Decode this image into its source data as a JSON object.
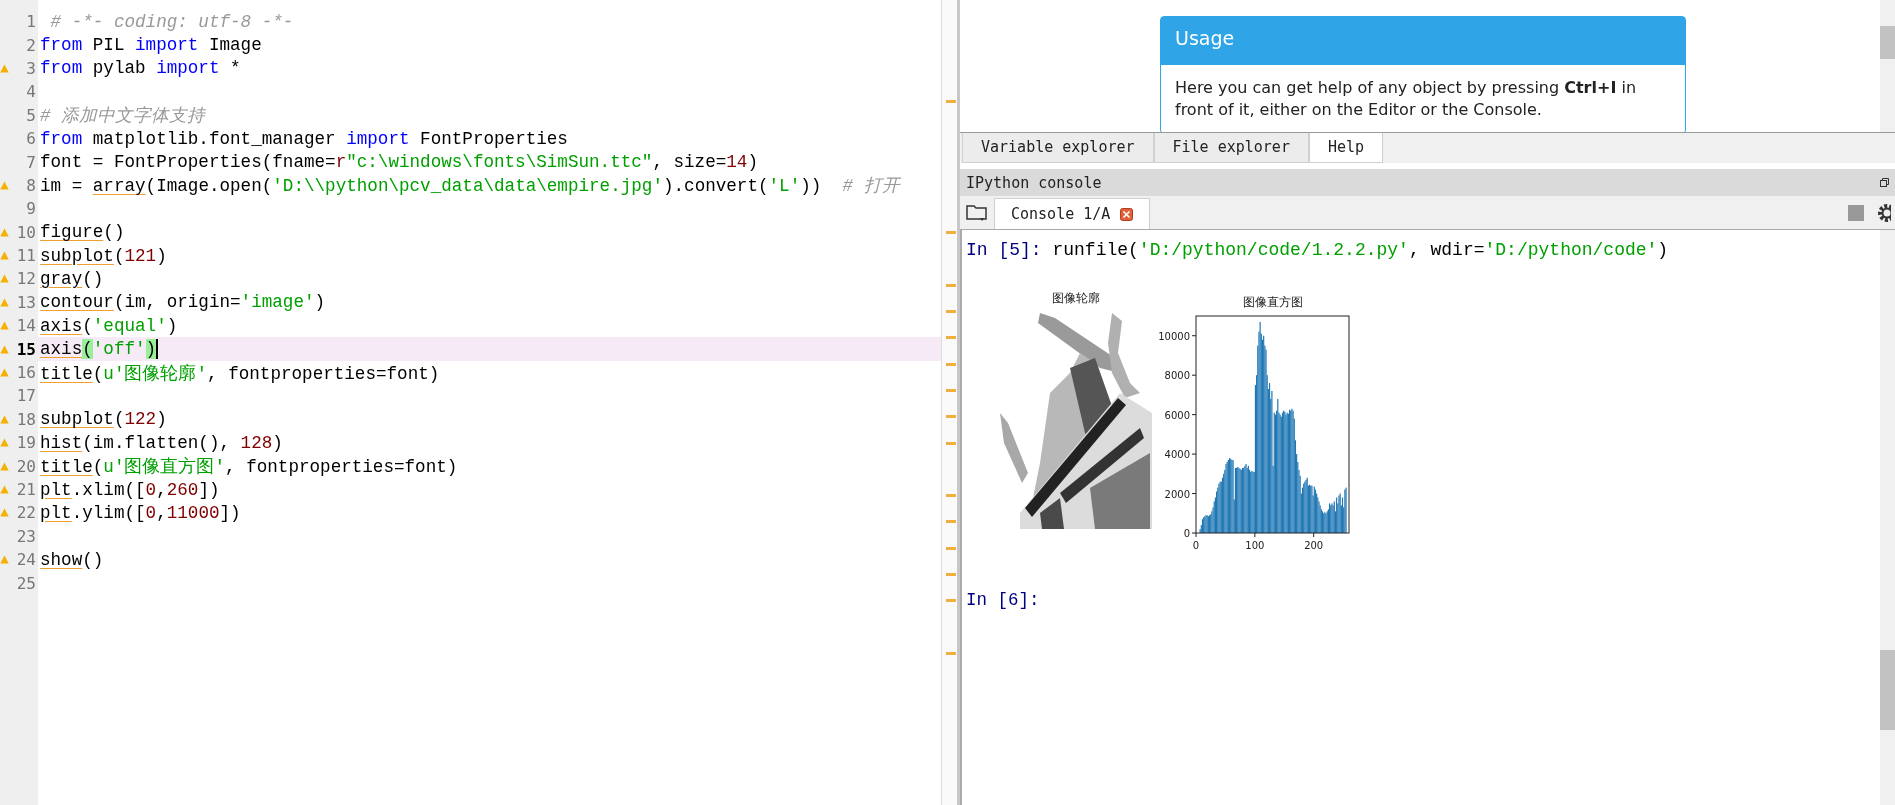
{
  "editor": {
    "lines": [
      {
        "number": "1",
        "warning": false,
        "current": false,
        "tokens": [
          {
            "text": " # -*- coding: utf-8 -*-",
            "kind": "comment"
          }
        ]
      },
      {
        "number": "2",
        "warning": false,
        "current": false,
        "tokens": [
          {
            "text": "from",
            "kind": "keyword"
          },
          {
            "text": " PIL ",
            "kind": "plain"
          },
          {
            "text": "import",
            "kind": "keyword"
          },
          {
            "text": " Image",
            "kind": "plain"
          }
        ]
      },
      {
        "number": "3",
        "warning": true,
        "current": false,
        "tokens": [
          {
            "text": "from",
            "kind": "keyword"
          },
          {
            "text": " pylab ",
            "kind": "plain"
          },
          {
            "text": "import",
            "kind": "keyword"
          },
          {
            "text": " *",
            "kind": "plain"
          }
        ]
      },
      {
        "number": "4",
        "warning": false,
        "current": false
      },
      {
        "number": "5",
        "warning": false,
        "current": false,
        "tokens": [
          {
            "text": "# 添加中文字体支持",
            "kind": "comment"
          }
        ]
      },
      {
        "number": "6",
        "warning": false,
        "current": false,
        "tokens": [
          {
            "text": "from",
            "kind": "keyword"
          },
          {
            "text": " matplotlib.font_manager ",
            "kind": "plain"
          },
          {
            "text": "import",
            "kind": "keyword"
          },
          {
            "text": " FontProperties",
            "kind": "plain"
          }
        ]
      },
      {
        "number": "7",
        "warning": false,
        "current": false,
        "tokens": [
          {
            "text": "font = FontProperties(fname=",
            "kind": "plain"
          },
          {
            "text": "r",
            "kind": "number"
          },
          {
            "text": "\"c:\\windows\\fonts\\SimSun.ttc\"",
            "kind": "string"
          },
          {
            "text": ", size=",
            "kind": "plain"
          },
          {
            "text": "14",
            "kind": "number"
          },
          {
            "text": ")",
            "kind": "plain"
          }
        ]
      },
      {
        "number": "8",
        "warning": true,
        "current": false,
        "tokens": [
          {
            "text": "im = ",
            "kind": "plain"
          },
          {
            "text": "array",
            "kind": "flagged"
          },
          {
            "text": "(Image.open(",
            "kind": "plain"
          },
          {
            "text": "'D:\\\\python\\pcv_data\\data\\empire.jpg'",
            "kind": "string"
          },
          {
            "text": ").convert(",
            "kind": "plain"
          },
          {
            "text": "'L'",
            "kind": "string"
          },
          {
            "text": "))  ",
            "kind": "plain"
          },
          {
            "text": "# 打开",
            "kind": "comment"
          }
        ]
      },
      {
        "number": "9",
        "warning": false,
        "current": false
      },
      {
        "number": "10",
        "warning": true,
        "current": false,
        "tokens": [
          {
            "text": "figure",
            "kind": "flagged"
          },
          {
            "text": "()",
            "kind": "plain"
          }
        ]
      },
      {
        "number": "11",
        "warning": true,
        "current": false,
        "tokens": [
          {
            "text": "subplot",
            "kind": "flagged"
          },
          {
            "text": "(",
            "kind": "plain"
          },
          {
            "text": "121",
            "kind": "number"
          },
          {
            "text": ")",
            "kind": "plain"
          }
        ]
      },
      {
        "number": "12",
        "warning": true,
        "current": false,
        "tokens": [
          {
            "text": "gray",
            "kind": "flagged"
          },
          {
            "text": "()",
            "kind": "plain"
          }
        ]
      },
      {
        "number": "13",
        "warning": true,
        "current": false,
        "tokens": [
          {
            "text": "contour",
            "kind": "flagged"
          },
          {
            "text": "(im, origin=",
            "kind": "plain"
          },
          {
            "text": "'image'",
            "kind": "string"
          },
          {
            "text": ")",
            "kind": "plain"
          }
        ]
      },
      {
        "number": "14",
        "warning": true,
        "current": false,
        "tokens": [
          {
            "text": "axis",
            "kind": "flagged"
          },
          {
            "text": "(",
            "kind": "plain"
          },
          {
            "text": "'equal'",
            "kind": "string"
          },
          {
            "text": ")",
            "kind": "plain"
          }
        ]
      },
      {
        "number": "15",
        "warning": true,
        "current": true,
        "tokens": [
          {
            "text": "axis",
            "kind": "flagged"
          },
          {
            "text": "(",
            "kind": "match"
          },
          {
            "text": "'off'",
            "kind": "string"
          },
          {
            "text": ")",
            "kind": "match"
          }
        ]
      },
      {
        "number": "16",
        "warning": true,
        "current": false,
        "tokens": [
          {
            "text": "title",
            "kind": "flagged"
          },
          {
            "text": "(",
            "kind": "plain"
          },
          {
            "text": "u'图像轮廓'",
            "kind": "string"
          },
          {
            "text": ", fontproperties=font)",
            "kind": "plain"
          }
        ]
      },
      {
        "number": "17",
        "warning": false,
        "current": false
      },
      {
        "number": "18",
        "warning": true,
        "current": false,
        "tokens": [
          {
            "text": "subplot",
            "kind": "flagged"
          },
          {
            "text": "(",
            "kind": "plain"
          },
          {
            "text": "122",
            "kind": "number"
          },
          {
            "text": ")",
            "kind": "plain"
          }
        ]
      },
      {
        "number": "19",
        "warning": true,
        "current": false,
        "tokens": [
          {
            "text": "hist",
            "kind": "flagged"
          },
          {
            "text": "(im.flatten(), ",
            "kind": "plain"
          },
          {
            "text": "128",
            "kind": "number"
          },
          {
            "text": ")",
            "kind": "plain"
          }
        ]
      },
      {
        "number": "20",
        "warning": true,
        "current": false,
        "tokens": [
          {
            "text": "title",
            "kind": "flagged"
          },
          {
            "text": "(",
            "kind": "plain"
          },
          {
            "text": "u'图像直方图'",
            "kind": "string"
          },
          {
            "text": ", fontproperties=font)",
            "kind": "plain"
          }
        ]
      },
      {
        "number": "21",
        "warning": true,
        "current": false,
        "tokens": [
          {
            "text": "plt",
            "kind": "flagged"
          },
          {
            "text": ".xlim([",
            "kind": "plain"
          },
          {
            "text": "0",
            "kind": "number"
          },
          {
            "text": ",",
            "kind": "plain"
          },
          {
            "text": "260",
            "kind": "number"
          },
          {
            "text": "])",
            "kind": "plain"
          }
        ]
      },
      {
        "number": "22",
        "warning": true,
        "current": false,
        "tokens": [
          {
            "text": "plt",
            "kind": "flagged"
          },
          {
            "text": ".ylim([",
            "kind": "plain"
          },
          {
            "text": "0",
            "kind": "number"
          },
          {
            "text": ",",
            "kind": "plain"
          },
          {
            "text": "11000",
            "kind": "number"
          },
          {
            "text": "])",
            "kind": "plain"
          }
        ]
      },
      {
        "number": "23",
        "warning": false,
        "current": false
      },
      {
        "number": "24",
        "warning": true,
        "current": false,
        "tokens": [
          {
            "text": "show",
            "kind": "flagged"
          },
          {
            "text": "()",
            "kind": "plain"
          }
        ]
      },
      {
        "number": "25",
        "warning": false,
        "current": false
      }
    ]
  },
  "help": {
    "card_title": "Usage",
    "card_text": "Here you can get help of any object by pressing **Ctrl+I** in front of it, either on the Editor or the Console."
  },
  "tabs": [
    {
      "label": "Variable explorer",
      "selected": false
    },
    {
      "label": "File explorer",
      "selected": false
    },
    {
      "label": "Help",
      "selected": true
    }
  ],
  "console": {
    "title": "IPython console",
    "tab": "Console 1/A",
    "input": {
      "prompt": "In [5]:",
      "tokens": [
        {
          "text": " runfile(",
          "kind": "plain"
        },
        {
          "text": "'D:/python/code/1.2.2.py'",
          "kind": "string"
        },
        {
          "text": ", wdir=",
          "kind": "plain"
        },
        {
          "text": "'D:/python/code'",
          "kind": "string"
        },
        {
          "text": ")",
          "kind": "plain"
        }
      ]
    },
    "figure": {
      "image_title": "图像轮廓",
      "chart_data": {
        "type": "bar",
        "title": "图像直方图",
        "xlim": [
          0,
          260
        ],
        "ylim": [
          0,
          11000
        ],
        "xticks": [
          0,
          100,
          200
        ],
        "yticks": [
          0,
          2000,
          4000,
          6000,
          8000,
          10000
        ],
        "x": [
          0,
          2,
          4,
          6,
          8,
          10,
          12,
          14,
          16,
          18,
          20,
          22,
          24,
          26,
          28,
          30,
          32,
          34,
          36,
          38,
          40,
          42,
          44,
          46,
          48,
          50,
          52,
          54,
          56,
          58,
          60,
          62,
          64,
          66,
          68,
          70,
          72,
          74,
          76,
          78,
          80,
          82,
          84,
          86,
          88,
          90,
          92,
          94,
          96,
          98,
          100,
          102,
          104,
          106,
          108,
          110,
          112,
          114,
          116,
          118,
          120,
          122,
          124,
          126,
          128,
          130,
          132,
          134,
          136,
          138,
          140,
          142,
          144,
          146,
          148,
          150,
          152,
          154,
          156,
          158,
          160,
          162,
          164,
          166,
          168,
          170,
          172,
          174,
          176,
          178,
          180,
          182,
          184,
          186,
          188,
          190,
          192,
          194,
          196,
          198,
          200,
          202,
          204,
          206,
          208,
          210,
          212,
          214,
          216,
          218,
          220,
          222,
          224,
          226,
          228,
          230,
          232,
          234,
          236,
          238,
          240,
          242,
          244,
          246,
          248,
          250,
          252,
          254
        ],
        "series": [
          {
            "color": "#1f77b4",
            "values": [
              0,
              0,
              0,
              200,
              400,
              700,
              800,
              850,
              900,
              900,
              850,
              900,
              950,
              1100,
              1300,
              1600,
              1800,
              2100,
              2300,
              2500,
              2600,
              2600,
              2800,
              3000,
              3200,
              3500,
              3600,
              3700,
              3800,
              3750,
              3700,
              3700,
              1700,
              3300,
              3300,
              3350,
              3300,
              3250,
              3200,
              3300,
              3300,
              3400,
              3500,
              3300,
              3400,
              3200,
              3100,
              3150,
              3100,
              3100,
              7500,
              8000,
              9500,
              10200,
              10700,
              10100,
              9800,
              10000,
              9500,
              9300,
              8000,
              7300,
              7600,
              6800,
              7200,
              3400,
              6100,
              6000,
              6200,
              6800,
              6100,
              6000,
              5900,
              6100,
              6200,
              6150,
              6000,
              6100,
              6050,
              6250,
              6200,
              6300,
              6200,
              5800,
              4700,
              4000,
              3600,
              3200,
              2900,
              2000,
              2300,
              2500,
              2600,
              2700,
              2800,
              2400,
              2450,
              2400,
              2400,
              1900,
              2350,
              2200,
              2000,
              1800,
              1600,
              1400,
              1200,
              1100,
              1000,
              1050,
              1000,
              1100,
              1200,
              1500,
              1400,
              1500,
              1400,
              1600,
              1100,
              1800,
              1500,
              1900,
              2000,
              1400,
              1800,
              1300,
              2200,
              2300
            ]
          }
        ]
      }
    },
    "next_prompt": "In [6]:"
  }
}
